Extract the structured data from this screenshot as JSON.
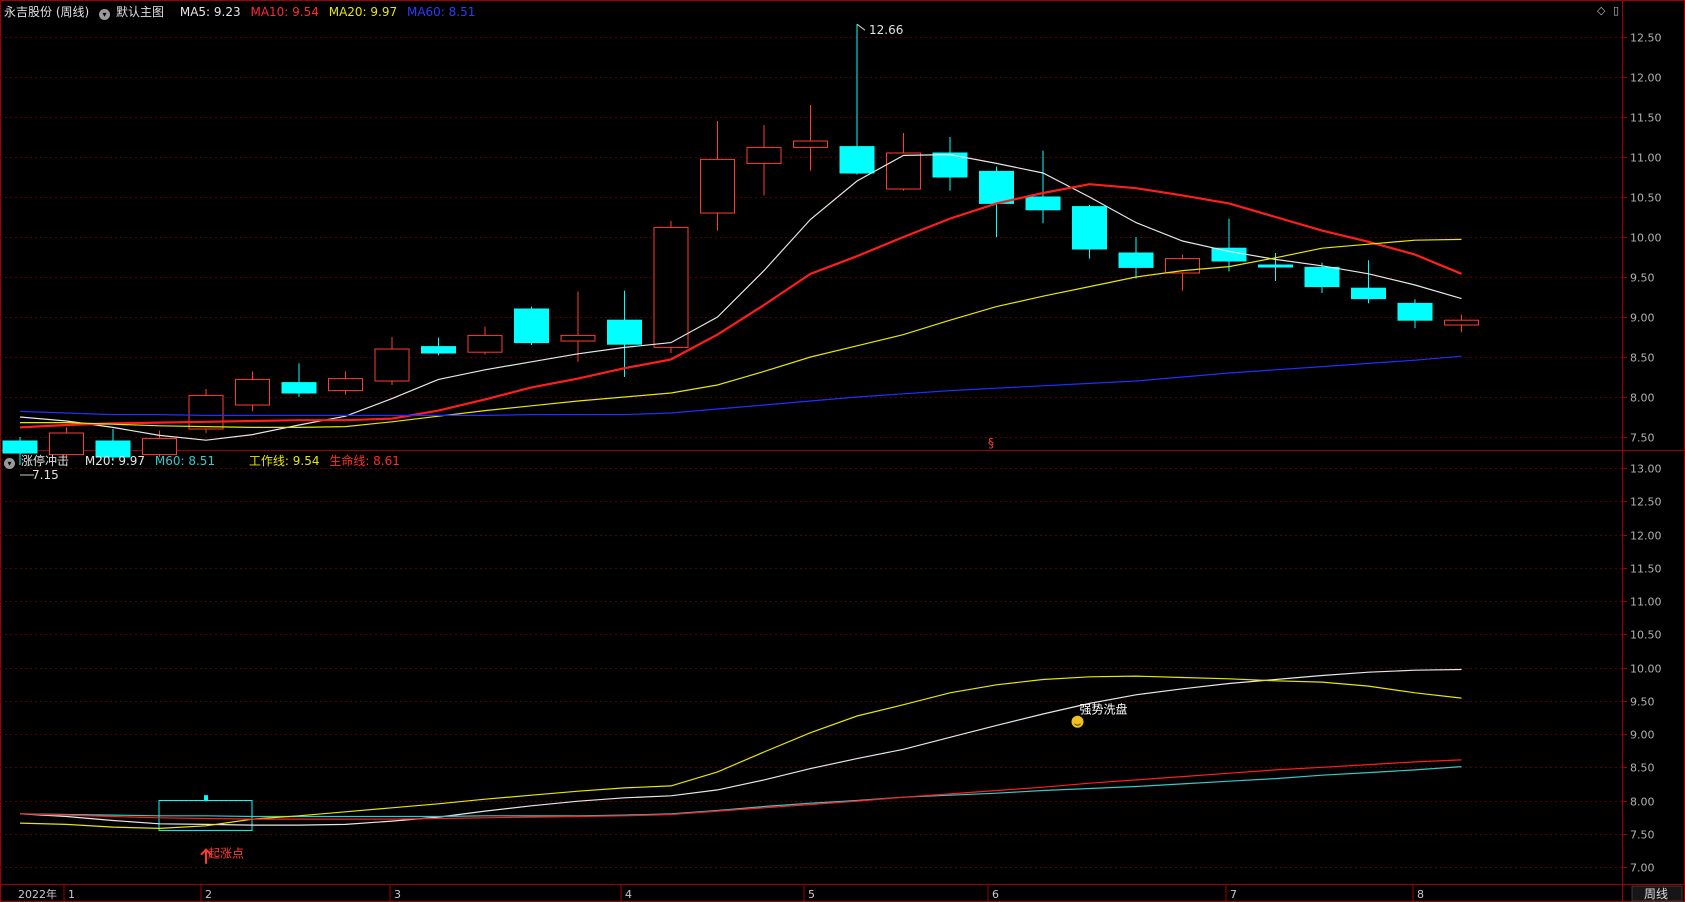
{
  "colors": {
    "background": "#000000",
    "up": "#ff3b30",
    "down": "#00ffff",
    "ma5": "#e6e6e6",
    "ma10": "#ff1e1e",
    "ma20": "#e6e600",
    "ma60": "#1f2fff",
    "grid": "#5a0000",
    "axis": "#a00000",
    "m60_lower": "#36c9c9"
  },
  "main_panel": {
    "stock_title": "永吉股份 (周线)",
    "indicator_name": "默认主图",
    "ma5_label": "MA5: 9.23",
    "ma10_label": "MA10: 9.54",
    "ma20_label": "MA20: 9.97",
    "ma60_label": "MA60: 8.51",
    "high_marker": "12.66",
    "low_marker": "7.15",
    "section_marker": "§",
    "controls": {
      "diamond_icon": "◇",
      "scroll_handle": "▯"
    }
  },
  "lower_panel": {
    "indicator_name": "涨停冲击",
    "m20_label": "M20: 9.97",
    "m60_label": "M60: 8.51",
    "work_line_label": "工作线: 9.54",
    "life_line_label": "生命线: 8.61",
    "signal_start": "起涨点",
    "signal_wash": "强势洗盘"
  },
  "bottom_axis": {
    "labels": [
      "2022年",
      "1",
      "2",
      "3",
      "4",
      "5",
      "6",
      "7",
      "8"
    ],
    "period_button": "周线"
  },
  "chart_data": [
    {
      "type": "candlestick",
      "title": "永吉股份 (周线)",
      "ylim": [
        7.0,
        12.7
      ],
      "yticks": [
        "12.50",
        "12.00",
        "11.50",
        "11.00",
        "10.50",
        "10.00",
        "9.50",
        "9.00",
        "8.50",
        "8.00",
        "7.50"
      ],
      "grid": true,
      "candles": [
        {
          "open": 7.45,
          "close": 7.3,
          "high": 7.5,
          "low": 7.15
        },
        {
          "open": 7.28,
          "close": 7.55,
          "high": 7.62,
          "low": 7.22
        },
        {
          "open": 7.45,
          "close": 7.25,
          "high": 7.6,
          "low": 7.2
        },
        {
          "open": 7.28,
          "close": 7.48,
          "high": 7.58,
          "low": 7.25
        },
        {
          "open": 7.6,
          "close": 8.02,
          "high": 8.1,
          "low": 7.55
        },
        {
          "open": 7.9,
          "close": 8.22,
          "high": 8.32,
          "low": 7.82
        },
        {
          "open": 8.18,
          "close": 8.05,
          "high": 8.42,
          "low": 8.0
        },
        {
          "open": 8.08,
          "close": 8.23,
          "high": 8.32,
          "low": 8.03
        },
        {
          "open": 8.2,
          "close": 8.6,
          "high": 8.75,
          "low": 8.15
        },
        {
          "open": 8.63,
          "close": 8.55,
          "high": 8.74,
          "low": 8.52
        },
        {
          "open": 8.56,
          "close": 8.77,
          "high": 8.88,
          "low": 8.53
        },
        {
          "open": 9.1,
          "close": 8.68,
          "high": 9.13,
          "low": 8.65
        },
        {
          "open": 8.7,
          "close": 8.77,
          "high": 9.32,
          "low": 8.44
        },
        {
          "open": 8.96,
          "close": 8.66,
          "high": 9.33,
          "low": 8.25
        },
        {
          "open": 8.62,
          "close": 10.12,
          "high": 10.2,
          "low": 8.55
        },
        {
          "open": 10.3,
          "close": 10.97,
          "high": 11.45,
          "low": 10.08
        },
        {
          "open": 10.92,
          "close": 11.12,
          "high": 11.4,
          "low": 10.52
        },
        {
          "open": 11.12,
          "close": 11.2,
          "high": 11.65,
          "low": 10.83
        },
        {
          "open": 11.13,
          "close": 10.8,
          "high": 12.66,
          "low": 10.78
        },
        {
          "open": 10.6,
          "close": 11.05,
          "high": 11.3,
          "low": 10.58
        },
        {
          "open": 11.05,
          "close": 10.75,
          "high": 11.25,
          "low": 10.58
        },
        {
          "open": 10.82,
          "close": 10.42,
          "high": 10.88,
          "low": 10.0
        },
        {
          "open": 10.5,
          "close": 10.34,
          "high": 11.08,
          "low": 10.17
        },
        {
          "open": 10.38,
          "close": 9.85,
          "high": 10.4,
          "low": 9.73
        },
        {
          "open": 9.8,
          "close": 9.62,
          "high": 10.0,
          "low": 9.48
        },
        {
          "open": 9.55,
          "close": 9.73,
          "high": 9.78,
          "low": 9.33
        },
        {
          "open": 9.86,
          "close": 9.7,
          "high": 10.23,
          "low": 9.57
        },
        {
          "open": 9.65,
          "close": 9.63,
          "high": 9.8,
          "low": 9.45
        },
        {
          "open": 9.62,
          "close": 9.38,
          "high": 9.68,
          "low": 9.3
        },
        {
          "open": 9.36,
          "close": 9.23,
          "high": 9.71,
          "low": 9.17
        },
        {
          "open": 9.17,
          "close": 8.96,
          "high": 9.22,
          "low": 8.86
        },
        {
          "open": 8.9,
          "close": 8.96,
          "high": 9.03,
          "low": 8.81
        }
      ],
      "series": [
        {
          "name": "MA5",
          "values": [
            7.75,
            7.7,
            7.62,
            7.52,
            7.46,
            7.53,
            7.65,
            7.76,
            7.98,
            8.22,
            8.34,
            8.44,
            8.54,
            8.62,
            8.68,
            9.0,
            9.58,
            10.22,
            10.7,
            11.02,
            11.03,
            10.92,
            10.8,
            10.5,
            10.18,
            9.95,
            9.82,
            9.72,
            9.64,
            9.54,
            9.4,
            9.23
          ]
        },
        {
          "name": "MA10",
          "values": [
            7.62,
            7.65,
            7.67,
            7.68,
            7.69,
            7.7,
            7.71,
            7.71,
            7.73,
            7.83,
            7.97,
            8.12,
            8.23,
            8.36,
            8.47,
            8.78,
            9.15,
            9.54,
            9.76,
            10.0,
            10.23,
            10.42,
            10.55,
            10.66,
            10.61,
            10.52,
            10.42,
            10.25,
            10.08,
            9.94,
            9.78,
            9.54
          ]
        },
        {
          "name": "MA20",
          "values": [
            7.68,
            7.68,
            7.66,
            7.64,
            7.63,
            7.62,
            7.62,
            7.63,
            7.69,
            7.76,
            7.83,
            7.89,
            7.95,
            8.0,
            8.05,
            8.15,
            8.32,
            8.5,
            8.64,
            8.78,
            8.96,
            9.13,
            9.26,
            9.38,
            9.5,
            9.58,
            9.63,
            9.74,
            9.86,
            9.91,
            9.96,
            9.97
          ]
        },
        {
          "name": "MA60",
          "values": [
            7.82,
            7.8,
            7.78,
            7.78,
            7.77,
            7.77,
            7.77,
            7.77,
            7.77,
            7.77,
            7.77,
            7.78,
            7.78,
            7.78,
            7.8,
            7.85,
            7.9,
            7.95,
            8.0,
            8.04,
            8.08,
            8.11,
            8.14,
            8.17,
            8.2,
            8.25,
            8.3,
            8.34,
            8.38,
            8.42,
            8.46,
            8.51
          ]
        }
      ]
    },
    {
      "type": "line",
      "title": "涨停冲击",
      "ylim": [
        6.85,
        13.15
      ],
      "yticks": [
        "13.00",
        "12.50",
        "12.00",
        "11.50",
        "11.00",
        "10.50",
        "10.00",
        "9.50",
        "9.00",
        "8.50",
        "8.00",
        "7.50",
        "7.00"
      ],
      "grid": true,
      "series": [
        {
          "name": "M20",
          "values": [
            7.8,
            7.76,
            7.7,
            7.65,
            7.64,
            7.63,
            7.63,
            7.64,
            7.69,
            7.75,
            7.84,
            7.92,
            7.99,
            8.04,
            8.07,
            8.16,
            8.31,
            8.48,
            8.63,
            8.77,
            8.95,
            9.13,
            9.3,
            9.46,
            9.59,
            9.68,
            9.76,
            9.82,
            9.88,
            9.93,
            9.96,
            9.97
          ]
        },
        {
          "name": "M60",
          "values": [
            7.8,
            7.79,
            7.78,
            7.77,
            7.77,
            7.76,
            7.76,
            7.76,
            7.76,
            7.76,
            7.77,
            7.77,
            7.77,
            7.78,
            7.8,
            7.85,
            7.91,
            7.96,
            8.0,
            8.05,
            8.08,
            8.11,
            8.15,
            8.18,
            8.21,
            8.25,
            8.29,
            8.33,
            8.38,
            8.42,
            8.46,
            8.51
          ]
        },
        {
          "name": "工作线",
          "values": [
            7.66,
            7.64,
            7.6,
            7.58,
            7.62,
            7.72,
            7.77,
            7.83,
            7.89,
            7.95,
            8.02,
            8.08,
            8.14,
            8.19,
            8.22,
            8.43,
            8.73,
            9.02,
            9.27,
            9.44,
            9.62,
            9.74,
            9.82,
            9.86,
            9.87,
            9.85,
            9.83,
            9.8,
            9.78,
            9.72,
            9.62,
            9.54
          ]
        },
        {
          "name": "生命线",
          "values": [
            7.8,
            7.78,
            7.76,
            7.74,
            7.73,
            7.72,
            7.72,
            7.72,
            7.72,
            7.73,
            7.74,
            7.75,
            7.76,
            7.77,
            7.79,
            7.84,
            7.89,
            7.94,
            7.99,
            8.05,
            8.1,
            8.15,
            8.2,
            8.26,
            8.31,
            8.36,
            8.41,
            8.46,
            8.5,
            8.54,
            8.58,
            8.61
          ]
        }
      ],
      "annotations": [
        {
          "label": "起涨点",
          "index": 4,
          "value": 7.2
        },
        {
          "label": "强势洗盘",
          "index": 23,
          "value": 9.2
        }
      ],
      "box": {
        "from": 3,
        "to": 5,
        "low": 7.55,
        "high": 8.0
      }
    }
  ]
}
